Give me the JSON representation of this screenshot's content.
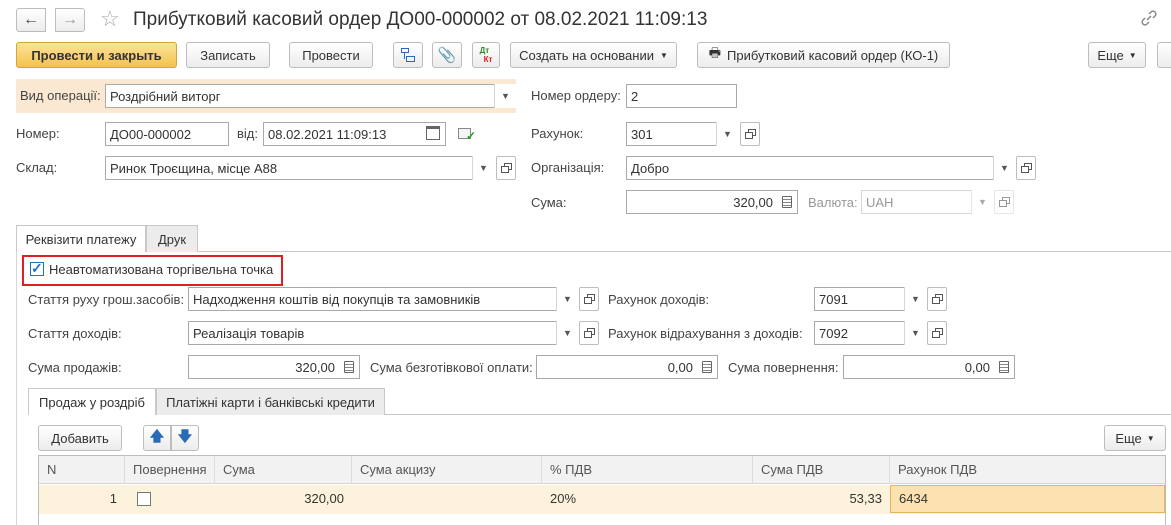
{
  "window": {
    "title": "Прибутковий касовий ордер ДО00-000002 от 08.02.2021 11:09:13"
  },
  "toolbar": {
    "post_and_close": "Провести и закрыть",
    "save": "Записать",
    "post": "Провести",
    "create_based_on": "Создать на основании",
    "print_form": "Прибутковий касовий ордер (КО-1)",
    "more": "Еще",
    "dt_kt_top": "Дт",
    "dt_kt_bottom": "Кт"
  },
  "header": {
    "operation_type_label": "Вид операції:",
    "operation_type_value": "Роздрібний виторг",
    "order_number_label": "Номер ордеру:",
    "order_number_value": "2",
    "number_label": "Номер:",
    "number_value": "ДО00-000002",
    "date_label": "від:",
    "date_value": "08.02.2021 11:09:13",
    "account_label": "Рахунок:",
    "account_value": "301",
    "warehouse_label": "Склад:",
    "warehouse_value": "Ринок Троєщина, місце А88",
    "organization_label": "Організація:",
    "organization_value": "Добро",
    "amount_label": "Сума:",
    "amount_value": "320,00",
    "currency_label": "Валюта:",
    "currency_value": "UAH"
  },
  "tabs": {
    "payment_details": "Реквізити платежу",
    "print": "Друк"
  },
  "payment": {
    "non_automated_checkbox_label": "Неавтоматизована торгівельна точка",
    "non_automated_checked": true,
    "cash_flow_label": "Стаття руху грош.засобів:",
    "cash_flow_value": "Надходження коштів від покупців та замовників",
    "income_account_label": "Рахунок доходів:",
    "income_account_value": "7091",
    "income_item_label": "Стаття доходів:",
    "income_item_value": "Реалізація товарів",
    "deduction_account_label": "Рахунок відрахування з доходів:",
    "deduction_account_value": "7092",
    "sales_amount_label": "Сума продажів:",
    "sales_amount_value": "320,00",
    "cashless_amount_label": "Сума безготівкової оплати:",
    "cashless_amount_value": "0,00",
    "return_amount_label": "Сума повернення:",
    "return_amount_value": "0,00"
  },
  "subtabs": {
    "retail_sale": "Продаж у роздріб",
    "cards_credits": "Платіжні карти і банківські кредити"
  },
  "table_toolbar": {
    "add": "Добавить",
    "more": "Еще"
  },
  "table": {
    "columns": [
      "N",
      "Повернення",
      "Сума",
      "Сума акцизу",
      "% ПДВ",
      "Сума ПДВ",
      "Рахунок ПДВ"
    ],
    "rows": [
      {
        "n": "1",
        "return_checked": false,
        "amount": "320,00",
        "excise": "",
        "vat_rate": "20%",
        "vat_amount": "53,33",
        "vat_account": "6434"
      }
    ]
  },
  "colors": {
    "accent_yellow": "#f4c24d",
    "highlight_label_bg": "#fbe8d2",
    "selected_row_bg": "#fdf3dc",
    "selected_cell_bg": "#fce2b0",
    "red_outline": "#e02020",
    "checkbox_blue": "#1e73c8"
  }
}
